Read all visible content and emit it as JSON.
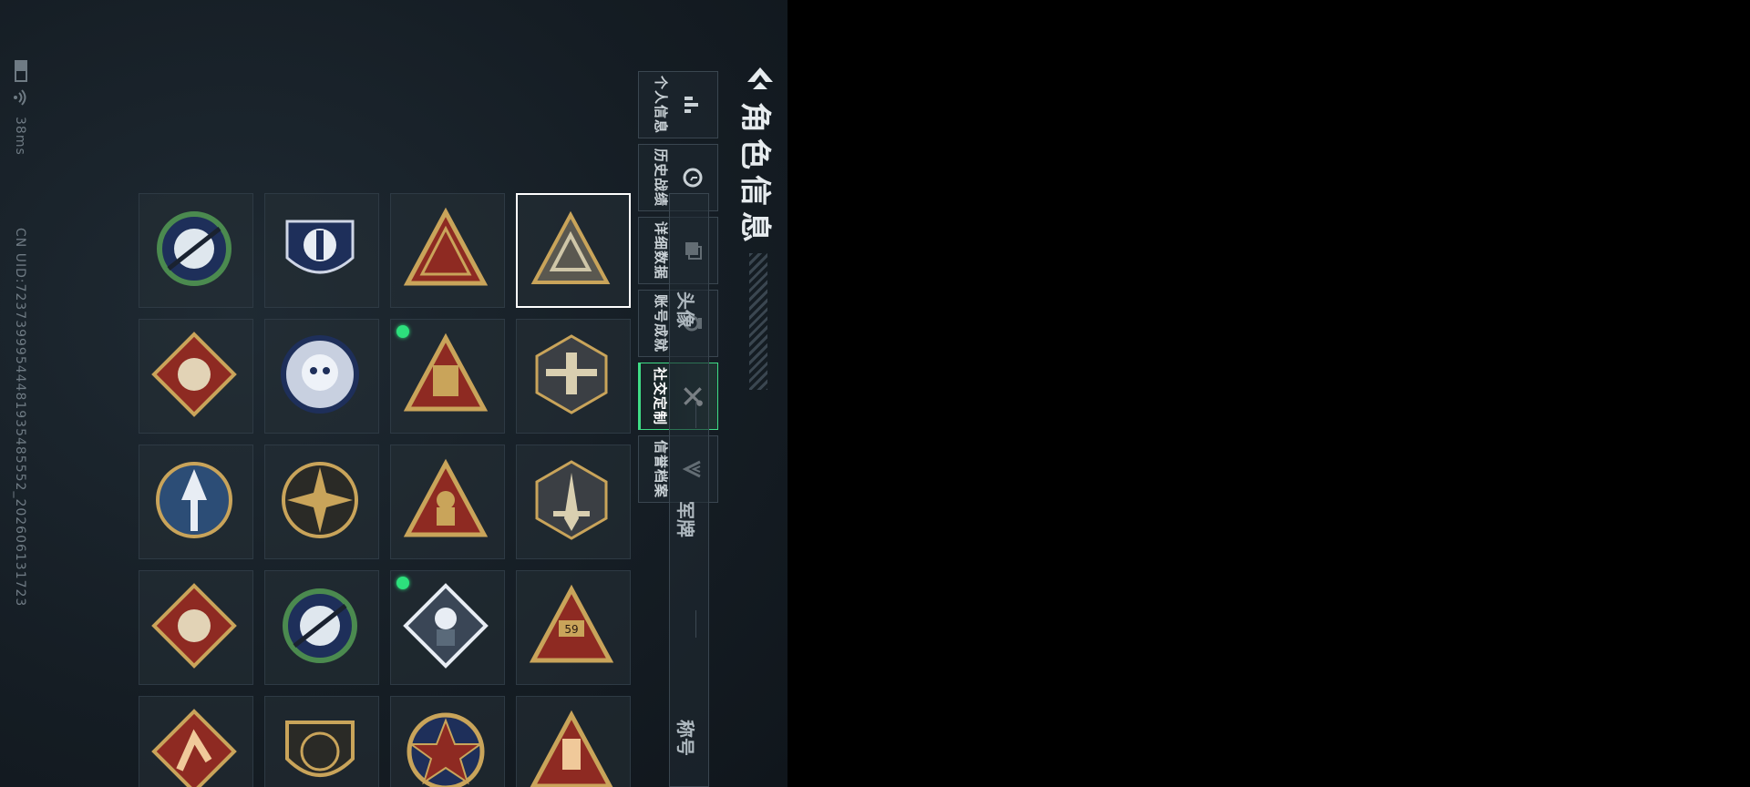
{
  "status_bar": {
    "ping": "38ms",
    "uid": "CN UID:72373999544481935485552_20260613172​3"
  },
  "header": {
    "title": "角色信息"
  },
  "tabs": [
    {
      "label": "个人信息",
      "icon": "bar-chart-icon"
    },
    {
      "label": "历史战绩",
      "icon": "clock-icon"
    },
    {
      "label": "详细数据",
      "icon": "cards-icon"
    },
    {
      "label": "账号成就",
      "icon": "medal-icon"
    },
    {
      "label": "社交定制",
      "icon": "tools-icon",
      "active": true
    },
    {
      "label": "信誉档案",
      "icon": "shield-v-icon"
    }
  ],
  "categories": [
    "头像",
    "军牌",
    "称号"
  ],
  "badges": [
    {
      "name": "triangle-emblem",
      "selected": true
    },
    {
      "name": "chevron-triangle-emblem"
    },
    {
      "name": "laurel-shield-emblem"
    },
    {
      "name": "rifle-crosshair-emblem"
    },
    {
      "name": "aircraft-emblem"
    },
    {
      "name": "tower-triangle-emblem",
      "new": true
    },
    {
      "name": "skull-emblem"
    },
    {
      "name": "wolf-emblem"
    },
    {
      "name": "sword-emblem"
    },
    {
      "name": "soldier-triangle-emblem"
    },
    {
      "name": "sunburst-emblem"
    },
    {
      "name": "arrow-emblem"
    },
    {
      "name": "crown-59-emblem"
    },
    {
      "name": "fist-diamond-emblem",
      "new": true
    },
    {
      "name": "sniper-emblem"
    },
    {
      "name": "dragon-emblem"
    },
    {
      "name": "hand-sign-emblem"
    },
    {
      "name": "star-medal-emblem"
    },
    {
      "name": "gun-shield-emblem"
    },
    {
      "name": "kick-emblem"
    }
  ],
  "colors": {
    "accent": "#3fdc86",
    "gold": "#c9a45a",
    "red": "#8e2a22",
    "navy": "#1e2f5a"
  }
}
